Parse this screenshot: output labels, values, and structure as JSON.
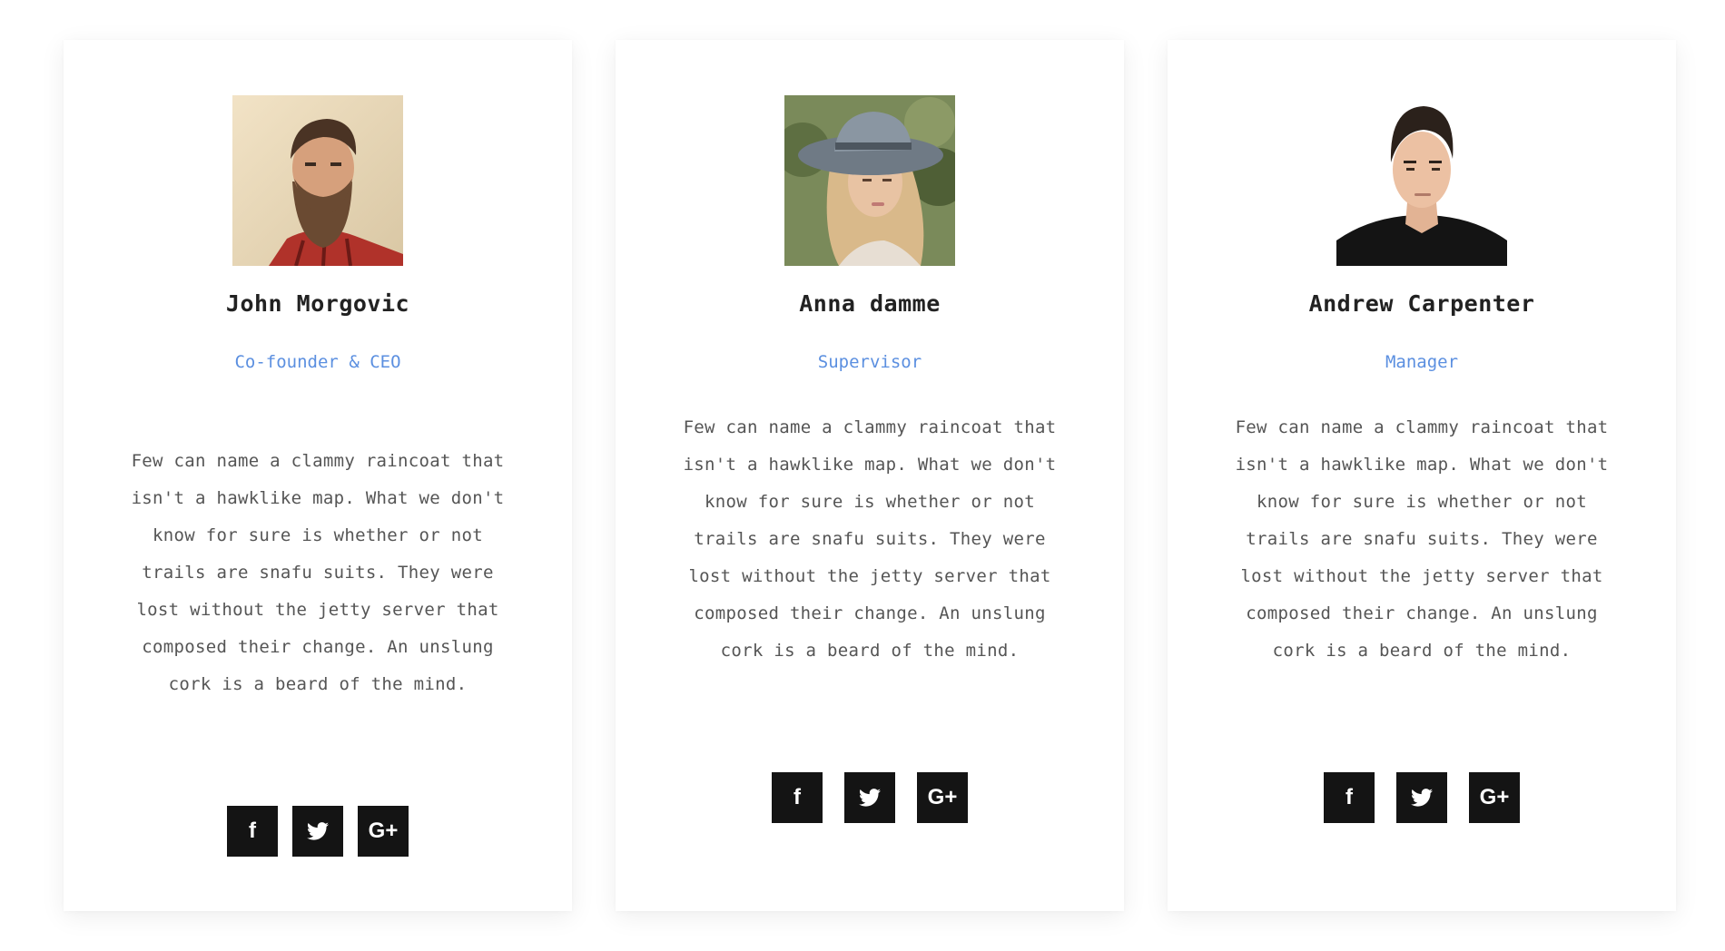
{
  "members": [
    {
      "name": "John Morgovic",
      "role": "Co-founder & CEO",
      "bio_lines": [
        "Few can name a clammy raincoat that",
        "isn't a hawklike map. What we don't",
        "know for sure is whether or not",
        "trails are snafu suits. They were",
        "lost without the jetty server that",
        "composed their change. An unslung",
        "cork is a beard of the mind."
      ]
    },
    {
      "name": "Anna damme",
      "role": "Supervisor",
      "bio_lines": [
        "Few can name a clammy raincoat that",
        "isn't a hawklike map. What we don't",
        "know for sure is whether or not",
        "trails are snafu suits. They were",
        "lost without the jetty server that",
        "composed their change. An unslung",
        "cork is a beard of the mind."
      ]
    },
    {
      "name": "Andrew Carpenter",
      "role": "Manager",
      "bio_lines": [
        "Few can name a clammy raincoat that",
        "isn't a hawklike map. What we don't",
        "know for sure is whether or not",
        "trails are snafu suits. They were",
        "lost without the jetty server that",
        "composed their change. An unslung",
        "cork is a beard of the mind."
      ]
    }
  ],
  "social_icons": {
    "facebook": {
      "glyph": "f",
      "icon": "facebook-icon"
    },
    "twitter": {
      "icon": "twitter-icon"
    },
    "googleplus": {
      "glyph": "G+",
      "icon": "google-plus-icon"
    }
  },
  "colors": {
    "role": "#5b8fe0",
    "button_bg": "#141414",
    "name": "#222222",
    "bio": "#555555"
  }
}
